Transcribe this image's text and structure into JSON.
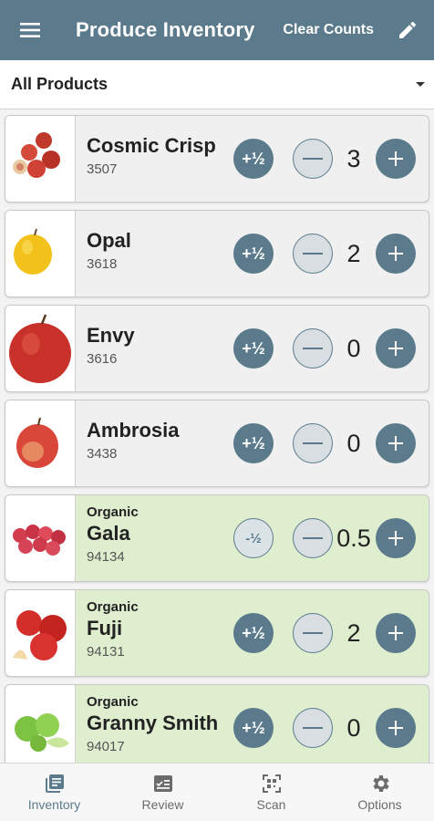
{
  "appbar": {
    "title": "Produce Inventory",
    "clear_label": "Clear Counts",
    "menu_icon": "hamburger-menu-icon",
    "edit_icon": "pencil-icon"
  },
  "filter": {
    "selected": "All Products"
  },
  "products": [
    {
      "name": "Cosmic Crisp",
      "code": "3507",
      "count": "3",
      "half": "+½",
      "organic": false
    },
    {
      "name": "Opal",
      "code": "3618",
      "count": "2",
      "half": "+½",
      "organic": false
    },
    {
      "name": "Envy",
      "code": "3616",
      "count": "0",
      "half": "+½",
      "organic": false
    },
    {
      "name": "Ambrosia",
      "code": "3438",
      "count": "0",
      "half": "+½",
      "organic": false
    },
    {
      "name": "Gala",
      "code": "94134",
      "count": "0.5",
      "half": "-½",
      "organic": true,
      "tag": "Organic"
    },
    {
      "name": "Fuji",
      "code": "94131",
      "count": "2",
      "half": "+½",
      "organic": true,
      "tag": "Organic"
    },
    {
      "name": "Granny Smith",
      "code": "94017",
      "count": "0",
      "half": "+½",
      "organic": true,
      "tag": "Organic"
    }
  ],
  "nav": [
    {
      "label": "Inventory",
      "icon": "inventory-icon",
      "active": true
    },
    {
      "label": "Review",
      "icon": "review-icon",
      "active": false
    },
    {
      "label": "Scan",
      "icon": "qr-scan-icon",
      "active": false
    },
    {
      "label": "Options",
      "icon": "gear-icon",
      "active": false
    }
  ],
  "colors": {
    "primary": "#5b7b8c",
    "organic_bg": "#dfeecf",
    "card_bg": "#f0f0f0"
  }
}
